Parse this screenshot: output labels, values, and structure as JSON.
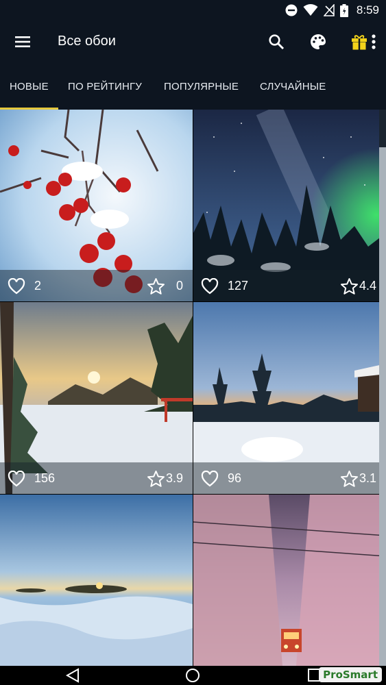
{
  "status_bar": {
    "time": "8:59"
  },
  "app": {
    "title": "Все обои"
  },
  "tabs": [
    {
      "label": "НОВЫЕ",
      "selected": true
    },
    {
      "label": "ПО РЕЙТИНГУ"
    },
    {
      "label": "ПОПУЛЯРНЫЕ"
    },
    {
      "label": "СЛУЧАЙНЫЕ"
    }
  ],
  "colors": {
    "bar_bg": "#0d1520",
    "tab_indicator": "#e6c93d",
    "gift": "#f2d21a"
  },
  "wallpapers": [
    {
      "scene": "red berries in snow",
      "likes": "2",
      "rating": "0"
    },
    {
      "scene": "starry sky over snowy forest",
      "likes": "127",
      "rating": "4.4"
    },
    {
      "scene": "winter sunset by frozen lake",
      "likes": "156",
      "rating": "3.9"
    },
    {
      "scene": "snowy forest at dusk",
      "likes": "96",
      "rating": "3.1"
    },
    {
      "scene": "sunrise over frozen sea"
    },
    {
      "scene": "train in snowy forest"
    }
  ],
  "watermark": "ProSmart",
  "icons": [
    "menu-icon",
    "search-icon",
    "palette-icon",
    "gift-icon",
    "more-vert-icon",
    "heart-icon",
    "star-icon",
    "back-icon",
    "home-icon",
    "recents-icon",
    "dnd-icon",
    "wifi-icon",
    "no-signal-icon",
    "battery-icon"
  ]
}
